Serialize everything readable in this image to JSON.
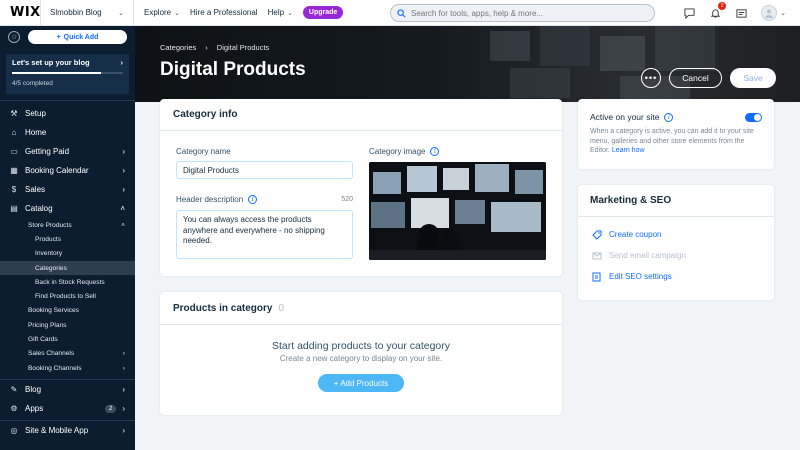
{
  "topbar": {
    "logo": "WIX",
    "site_name": "Slmobbin Blog",
    "nav": [
      "Explore",
      "Hire a Professional",
      "Help"
    ],
    "upgrade": "Upgrade",
    "search_placeholder": "Search for tools, apps, help & more...",
    "notification_count": "2"
  },
  "sidebar": {
    "quick_add": "Quick Add",
    "setup_title": "Let's set up your blog",
    "setup_progress": 0.8,
    "setup_count": "4/5 completed",
    "items": [
      {
        "label": "Setup"
      },
      {
        "label": "Home"
      },
      {
        "label": "Getting Paid"
      },
      {
        "label": "Booking Calendar"
      },
      {
        "label": "Sales"
      },
      {
        "label": "Catalog"
      }
    ],
    "catalog_sub": {
      "store_products": "Store Products",
      "products": "Products",
      "inventory": "Inventory",
      "categories": "Categories",
      "back_in_stock": "Back in Stock Requests",
      "find_products": "Find Products to Sell",
      "booking_services": "Booking Services",
      "pricing_plans": "Pricing Plans",
      "gift_cards": "Gift Cards",
      "sales_channels": "Sales Channels",
      "booking_channels": "Booking Channels"
    },
    "bottom": {
      "blog": "Blog",
      "apps": "Apps",
      "apps_count": "2",
      "site_mobile": "Site & Mobile App"
    }
  },
  "hero": {
    "breadcrumb_root": "Categories",
    "breadcrumb_current": "Digital Products",
    "title": "Digital Products",
    "more": "•••",
    "cancel": "Cancel",
    "save": "Save"
  },
  "category_info": {
    "title": "Category info",
    "name_label": "Category name",
    "name_value": "Digital Products",
    "image_label": "Category image",
    "desc_label": "Header description",
    "desc_counter": "520",
    "desc_value": "You can always access the products anywhere and everywhere - no shipping needed."
  },
  "products_in_category": {
    "title": "Products in category",
    "count": "0",
    "empty_title": "Start adding products to your category",
    "empty_subtitle": "Create a new category to display on your site.",
    "add_button": "+ Add Products"
  },
  "active_panel": {
    "title": "Active on your site",
    "active": true,
    "description": "When a category is active, you can add it to your site menu, galleries and other store elements from the Editor.",
    "learn_how": "Learn how"
  },
  "marketing": {
    "title": "Marketing & SEO",
    "items": [
      "Create coupon",
      "Send email campaign",
      "Edit SEO settings"
    ]
  },
  "colors": {
    "accent": "#116dff",
    "upgrade": "#9a27d5",
    "sidebar_bg": "#0c1d2f"
  }
}
